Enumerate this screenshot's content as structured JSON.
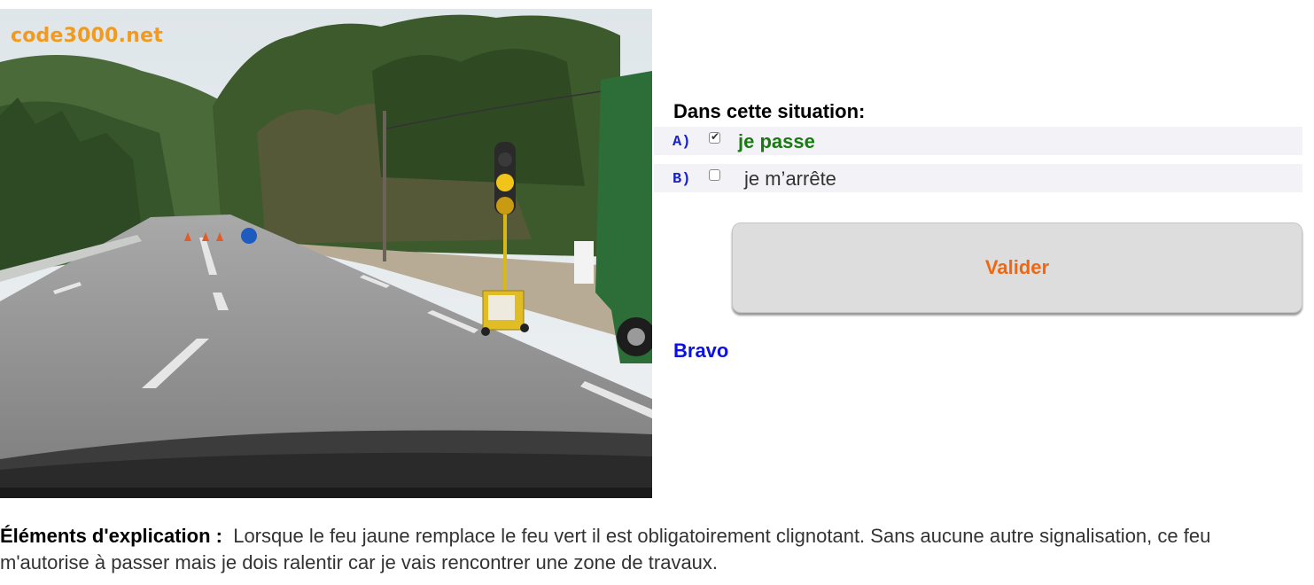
{
  "image": {
    "watermark": "code3000.net",
    "description_icon": "road-photo-icon"
  },
  "question": {
    "prompt": "Dans cette situation:",
    "answers": [
      {
        "letter": "A)",
        "text": "je passe",
        "checked": true
      },
      {
        "letter": "B)",
        "text": "je m’arrête",
        "checked": false
      }
    ]
  },
  "actions": {
    "validate_label": "Valider"
  },
  "feedback": {
    "result": "Bravo"
  },
  "explanation": {
    "label": "Éléments d'explication :",
    "text": "Lorsque le feu jaune remplace le feu vert il est obligatoirement clignotant. Sans aucune autre signalisation, ce feu m'autorise à passer mais je dois ralentir car je vais rencontrer une zone de travaux."
  },
  "colors": {
    "watermark": "#f29a1d",
    "answer_letter": "#1a23c8",
    "correct_answer": "#197a12",
    "validate_text": "#f0670f",
    "bravo": "#0b10e3"
  }
}
